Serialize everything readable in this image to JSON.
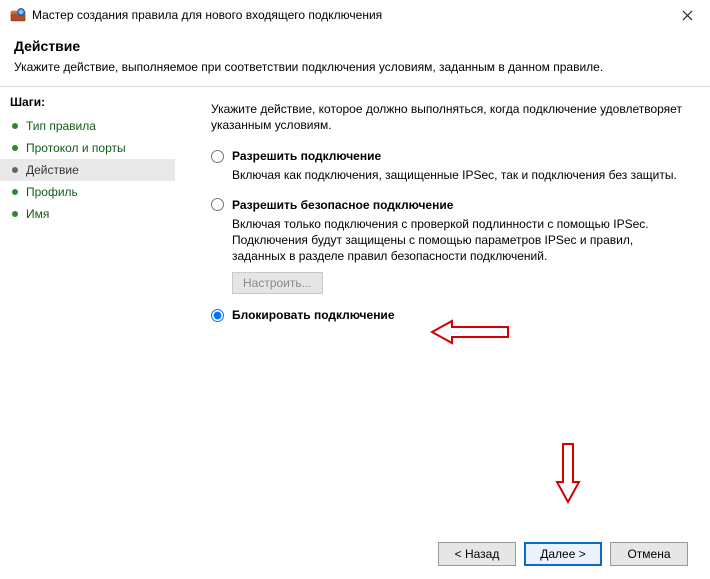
{
  "window": {
    "title": "Мастер создания правила для нового входящего подключения"
  },
  "header": {
    "title": "Действие",
    "subtitle": "Укажите действие, выполняемое при соответствии подключения условиям, заданным в данном правиле."
  },
  "sidebar": {
    "title": "Шаги:",
    "steps": [
      {
        "label": "Тип правила",
        "current": false
      },
      {
        "label": "Протокол и порты",
        "current": false
      },
      {
        "label": "Действие",
        "current": true
      },
      {
        "label": "Профиль",
        "current": false
      },
      {
        "label": "Имя",
        "current": false
      }
    ]
  },
  "main": {
    "instruction": "Укажите действие, которое должно выполняться, когда подключение удовлетворяет указанным условиям.",
    "options": [
      {
        "id": "allow",
        "label": "Разрешить подключение",
        "desc": "Включая как подключения, защищенные IPSec, так и подключения без защиты.",
        "selected": false
      },
      {
        "id": "allow-secure",
        "label": "Разрешить безопасное подключение",
        "desc": "Включая только подключения с проверкой подлинности с помощью IPSec. Подключения будут защищены с помощью параметров IPSec и правил, заданных в разделе правил безопасности подключений.",
        "selected": false,
        "config_button": "Настроить..."
      },
      {
        "id": "block",
        "label": "Блокировать подключение",
        "desc": "",
        "selected": true
      }
    ]
  },
  "footer": {
    "back": "< Назад",
    "next": "Далее >",
    "cancel": "Отмена"
  }
}
